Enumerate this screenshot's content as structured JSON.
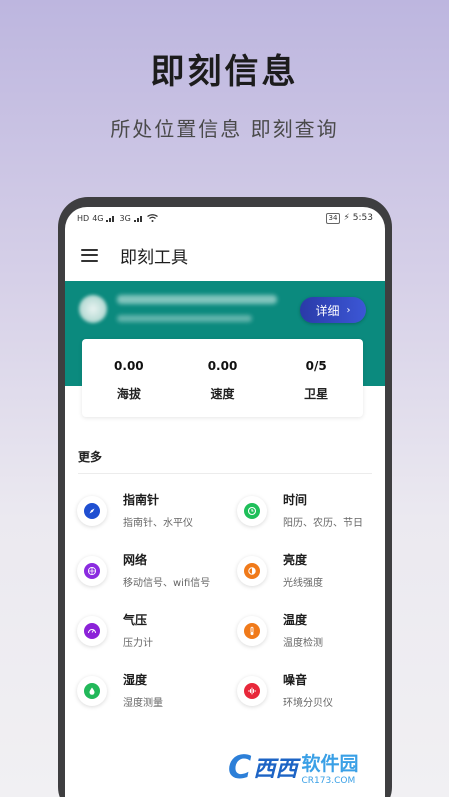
{
  "hero": {
    "title": "即刻信息",
    "subtitle": "所处位置信息 即刻查询"
  },
  "statusbar": {
    "left_labels": [
      "HD",
      "4G",
      "3G"
    ],
    "battery": "34",
    "time": "5:53"
  },
  "appbar": {
    "title": "即刻工具"
  },
  "banner": {
    "detail_label": "详细",
    "detail_chevron": "›"
  },
  "stats": [
    {
      "value": "0.00",
      "label": "海拔"
    },
    {
      "value": "0.00",
      "label": "速度"
    },
    {
      "value": "0/5",
      "label": "卫星"
    }
  ],
  "section": {
    "title": "更多"
  },
  "tools": [
    {
      "title": "指南针",
      "desc": "指南针、水平仪",
      "icon": "compass-icon",
      "color": "#1f4fd1"
    },
    {
      "title": "时间",
      "desc": "阳历、农历、节日",
      "icon": "clock-icon",
      "color": "#1fbf5a"
    },
    {
      "title": "网络",
      "desc": "移动信号、wifi信号",
      "icon": "network-icon",
      "color": "#8a2be0"
    },
    {
      "title": "亮度",
      "desc": "光线强度",
      "icon": "brightness-icon",
      "color": "#f07a1a"
    },
    {
      "title": "气压",
      "desc": "压力计",
      "icon": "gauge-icon",
      "color": "#8b22d8"
    },
    {
      "title": "温度",
      "desc": "温度检测",
      "icon": "thermometer-icon",
      "color": "#f07a1a"
    },
    {
      "title": "湿度",
      "desc": "湿度测量",
      "icon": "humidity-icon",
      "color": "#22b85a"
    },
    {
      "title": "噪音",
      "desc": "环境分贝仪",
      "icon": "sound-icon",
      "color": "#e8283a"
    }
  ],
  "watermark": {
    "logo": "C",
    "cn": "西西",
    "name": "软件园",
    "url": "CR173.COM"
  }
}
